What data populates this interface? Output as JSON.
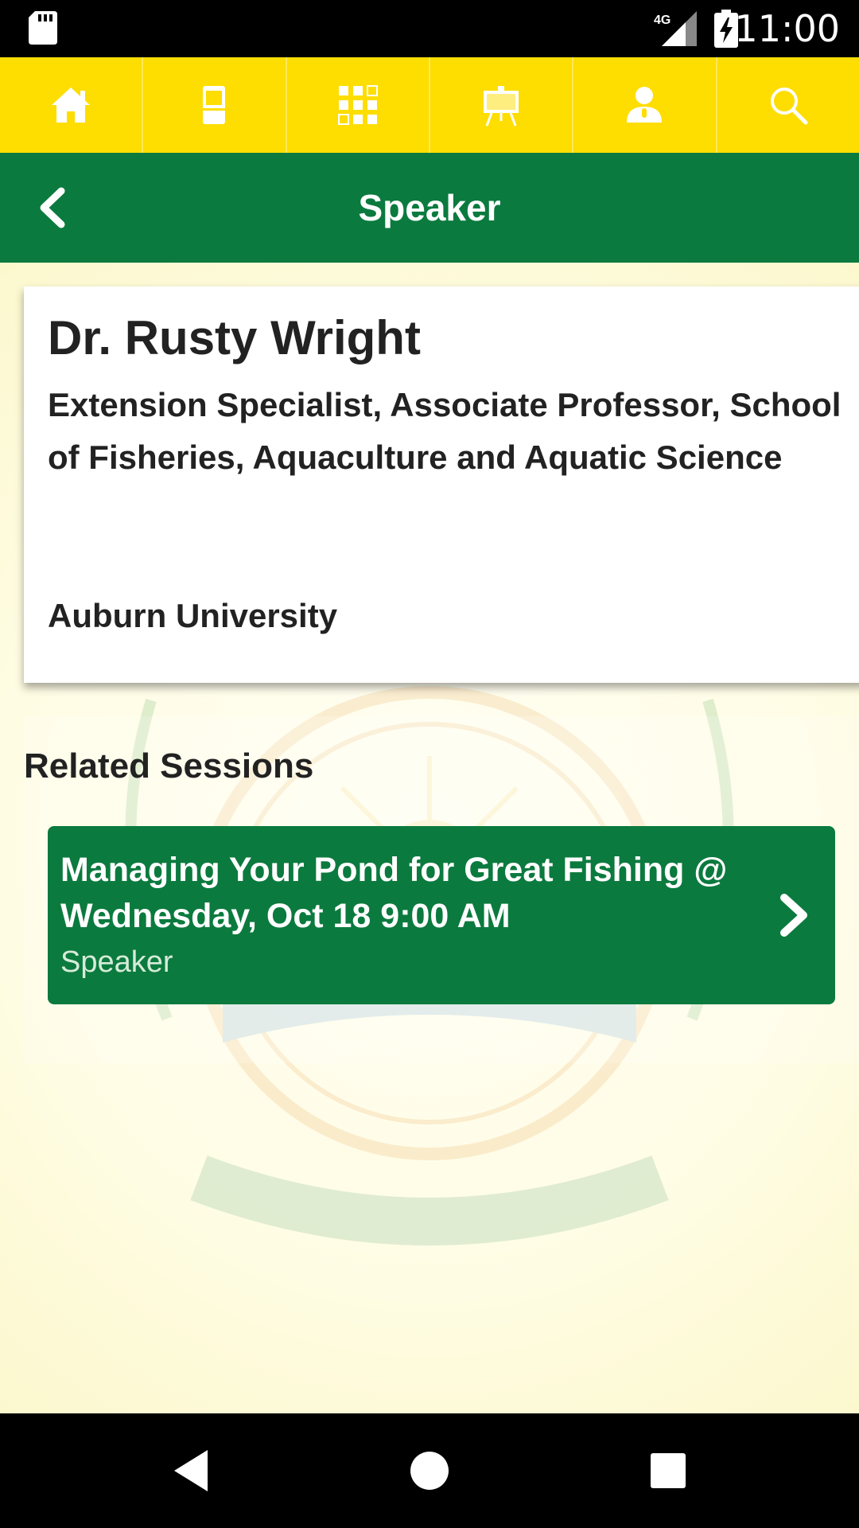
{
  "status_bar": {
    "network": "4G",
    "time": "11:00"
  },
  "nav": {
    "items": [
      {
        "icon": "home-icon"
      },
      {
        "icon": "booth-icon"
      },
      {
        "icon": "grid-icon"
      },
      {
        "icon": "presentation-icon"
      },
      {
        "icon": "speaker-icon"
      },
      {
        "icon": "search-icon"
      }
    ]
  },
  "header": {
    "title": "Speaker"
  },
  "speaker": {
    "name": "Dr. Rusty Wright",
    "title": "Extension Specialist, Associate Professor, School of Fisheries, Aquaculture and Aquatic Science",
    "organization": "Auburn University"
  },
  "related": {
    "heading": "Related Sessions",
    "sessions": [
      {
        "title": "Managing Your Pond for Great Fishing @ Wednesday, Oct 18 9:00 AM",
        "role": "Speaker"
      }
    ]
  },
  "colors": {
    "nav_bg": "#FEDD00",
    "header_bg": "#0B7A3E",
    "session_bg": "#0B7A3E"
  }
}
